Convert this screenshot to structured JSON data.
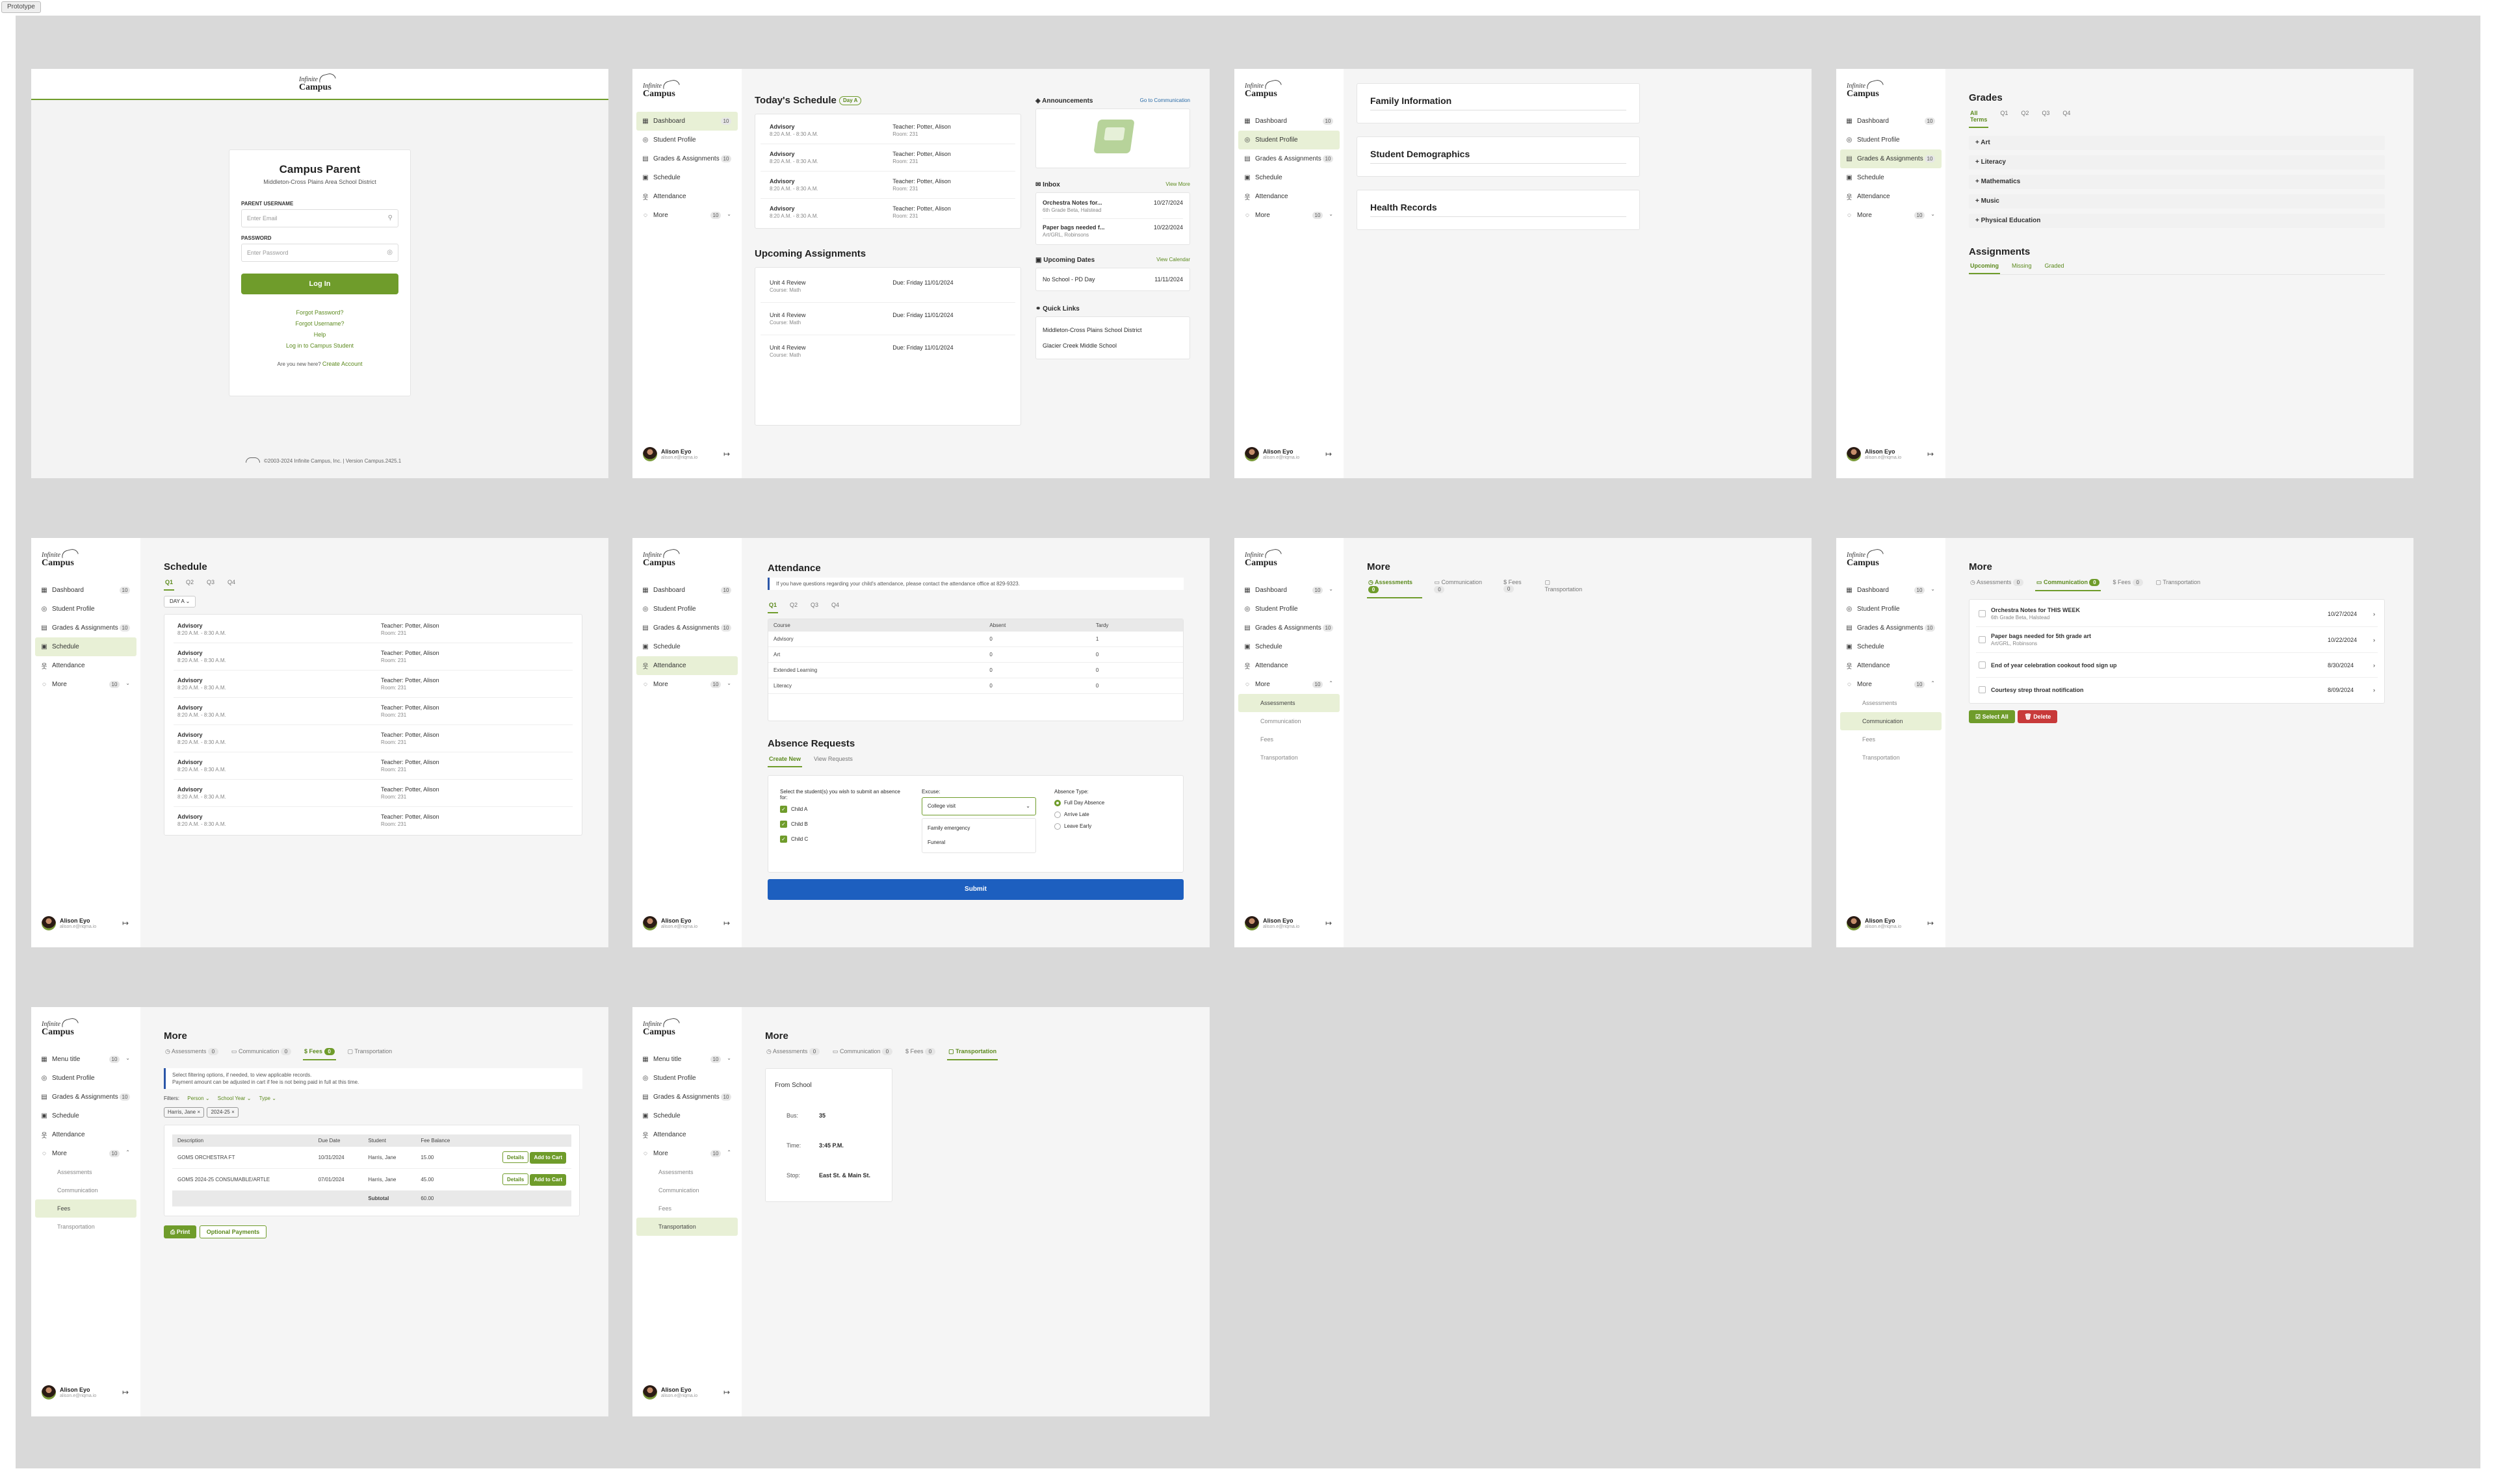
{
  "canvas_label": "Prototype",
  "sidebar": {
    "logo_top": "Infinite",
    "logo_bottom": "Campus",
    "dashboard": "Dashboard",
    "menu_title": "Menu title",
    "student_profile": "Student Profile",
    "grades": "Grades & Assignments",
    "schedule": "Schedule",
    "attendance": "Attendance",
    "more": "More",
    "assessments": "Assessments",
    "communication": "Communication",
    "fees": "Fees",
    "transportation": "Transportation",
    "badge_dashboard": "10",
    "badge_grades": "10",
    "badge_more": "10",
    "user_name": "Alison Eyo",
    "user_email": "alison.e@riqma.io"
  },
  "login": {
    "title": "Campus Parent",
    "district": "Middleton-Cross Plains Area School District",
    "user_label": "PARENT USERNAME",
    "user_placeholder": "Enter Email",
    "pass_label": "PASSWORD",
    "pass_placeholder": "Enter Password",
    "login_button": "Log In",
    "forgot_password": "Forgot Password?",
    "forgot_username": "Forgot Username?",
    "help": "Help",
    "campus_student": "Log in to Campus Student",
    "new_here": "Are you new here?",
    "create_account": "Create Account",
    "copyright": "©2003-2024 Infinite Campus, Inc. | Version Campus.2425.1"
  },
  "dashboard": {
    "schedule_title": "Today's Schedule",
    "schedule_day": "Day A",
    "schedule_rows": [
      {
        "course": "Advisory",
        "time": "8:20 A.M. - 8:30 A.M.",
        "teacher": "Teacher: Potter, Alison",
        "room": "Room: 231"
      },
      {
        "course": "Advisory",
        "time": "8:20 A.M. - 8:30 A.M.",
        "teacher": "Teacher: Potter, Alison",
        "room": "Room: 231"
      },
      {
        "course": "Advisory",
        "time": "8:20 A.M. - 8:30 A.M.",
        "teacher": "Teacher: Potter, Alison",
        "room": "Room: 231"
      },
      {
        "course": "Advisory",
        "time": "8:20 A.M. - 8:30 A.M.",
        "teacher": "Teacher: Potter, Alison",
        "room": "Room: 231"
      }
    ],
    "assign_title": "Upcoming Assignments",
    "assign_rows": [
      {
        "name": "Unit 4 Review",
        "course": "Course: Math",
        "due": "Due: Friday 11/01/2024"
      },
      {
        "name": "Unit 4 Review",
        "course": "Course: Math",
        "due": "Due: Friday 11/01/2024"
      },
      {
        "name": "Unit 4 Review",
        "course": "Course: Math",
        "due": "Due: Friday 11/01/2024"
      }
    ],
    "announce_title": "Announcements",
    "announce_link": "Go to Communication",
    "inbox_title": "Inbox",
    "inbox_link": "View More",
    "inbox_rows": [
      {
        "title": "Orchestra Notes for...",
        "sub": "6th Grade Beta, Halstead",
        "date": "10/27/2024"
      },
      {
        "title": "Paper bags needed f...",
        "sub": "Art/GRL, Robinsons",
        "date": "10/22/2024"
      }
    ],
    "dates_title": "Upcoming Dates",
    "dates_link": "View Calendar",
    "dates_rows": [
      {
        "name": "No School - PD Day",
        "date": "11/11/2024"
      }
    ],
    "links_title": "Quick Links",
    "links": [
      "Middleton-Cross Plains School District",
      "Glacier Creek Middle School"
    ]
  },
  "profile": {
    "family": "Family Information",
    "demographics": "Student Demographics",
    "health": "Health Records"
  },
  "grades": {
    "title": "Grades",
    "terms": [
      "All Terms",
      "Q1",
      "Q2",
      "Q3",
      "Q4"
    ],
    "subjects": [
      "Art",
      "Literacy",
      "Mathematics",
      "Music",
      "Physical Education"
    ],
    "assign_title": "Assignments",
    "assign_tabs": [
      "Upcoming",
      "Missing",
      "Graded"
    ]
  },
  "schedule": {
    "title": "Schedule",
    "quarters": [
      "Q1",
      "Q2",
      "Q3",
      "Q4"
    ],
    "day_select": "DAY A",
    "course": "Advisory",
    "time": "8:20 A.M. - 8:30 A.M.",
    "teacher": "Teacher: Potter, Alison",
    "room": "Room: 231"
  },
  "attendance": {
    "title": "Attendance",
    "notice": "If you have questions regarding your child's attendance, please contact the attendance office at 829-9323.",
    "quarters": [
      "Q1",
      "Q2",
      "Q3",
      "Q4"
    ],
    "headers": [
      "Course",
      "Absent",
      "Tardy"
    ],
    "rows": [
      [
        "Advisory",
        "0",
        "1"
      ],
      [
        "Art",
        "0",
        "0"
      ],
      [
        "Extended Learning",
        "0",
        "0"
      ],
      [
        "Literacy",
        "0",
        "0"
      ]
    ],
    "req_title": "Absence Requests",
    "req_tabs": [
      "Create New",
      "View Requests"
    ],
    "select_label": "Select the student(s) you wish to submit an absence for:",
    "children": [
      "Child A",
      "Child B",
      "Child C"
    ],
    "excuse_label": "Excuse:",
    "excuse_value": "College visit",
    "excuse_options": [
      "Family emergency",
      "Funeral"
    ],
    "type_label": "Absence Type:",
    "types": [
      "Full Day Absence",
      "Arrive Late",
      "Leave Early"
    ],
    "submit": "Submit"
  },
  "more": {
    "title": "More",
    "tab_assess": "Assessments",
    "tab_comm": "Communication",
    "tab_fees": "Fees",
    "tab_trans": "Transportation",
    "badge": "0",
    "comm_rows": [
      {
        "title": "Orchestra Notes for THIS WEEK",
        "sub": "6th Grade Beta, Halstead",
        "date": "10/27/2024"
      },
      {
        "title": "Paper bags needed for 5th grade art",
        "sub": "Art/GRL, Robinsons",
        "date": "10/22/2024"
      },
      {
        "title": "End of year celebration cookout food sign up",
        "sub": "",
        "date": "8/30/2024"
      },
      {
        "title": "Courtesy strep throat notification",
        "sub": "",
        "date": "8/09/2024"
      }
    ],
    "select_all": "Select All",
    "delete": "Delete"
  },
  "fees": {
    "notice1": "Select filtering options, if needed, to view applicable records.",
    "notice2": "Payment amount can be adjusted in cart if fee is not being paid in full at this time.",
    "filters": "Filters:",
    "filter_person": "Person",
    "filter_year": "School Year",
    "filter_type": "Type",
    "chip1": "Harris, Jane",
    "chip2": "2024-25",
    "headers": [
      "Description",
      "Due Date",
      "Student",
      "Fee Balance"
    ],
    "rows": [
      {
        "desc": "GOMS ORCHESTRA FT",
        "due": "10/31/2024",
        "student": "Harris, Jane",
        "bal": "15.00"
      },
      {
        "desc": "GOMS 2024-25 CONSUMABLE/ARTLE",
        "due": "07/01/2024",
        "student": "Harris, Jane",
        "bal": "45.00"
      }
    ],
    "subtotal_label": "Subtotal",
    "subtotal": "60.00",
    "details": "Details",
    "add_cart": "Add to Cart",
    "print": "Print",
    "optional": "Optional Payments"
  },
  "transport": {
    "heading": "From School",
    "bus_label": "Bus:",
    "bus": "35",
    "time_label": "Time:",
    "time": "3:45 P.M.",
    "stop_label": "Stop:",
    "stop": "East St. & Main St."
  }
}
